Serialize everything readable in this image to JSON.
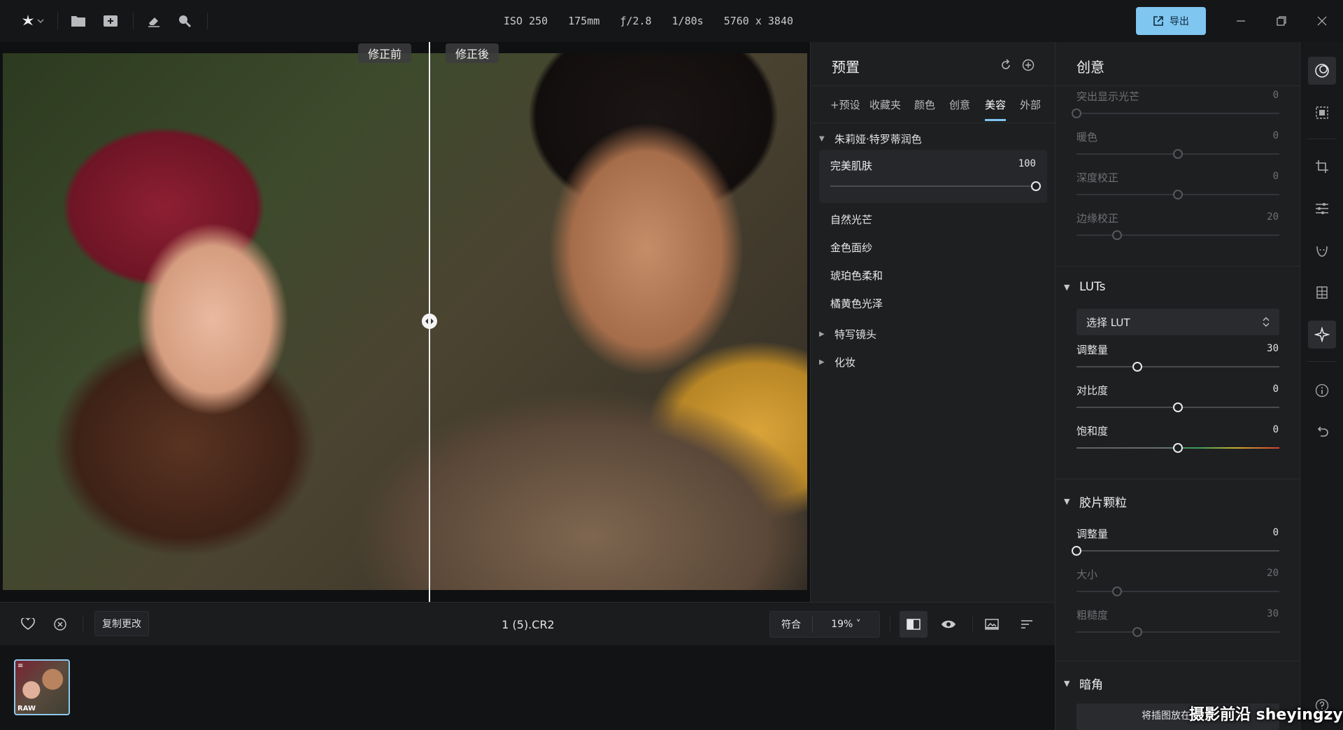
{
  "topbar": {
    "exif": [
      "ISO 250",
      "175mm",
      "ƒ/2.8",
      "1/80s",
      "5760 x 3840"
    ],
    "export_label": "导出",
    "icons": [
      "app-logo-star-icon",
      "chevron-down-icon",
      "folder-icon",
      "add-image-icon",
      "eraser-icon",
      "zoom-icon"
    ]
  },
  "viewer": {
    "before_label": "修正前",
    "after_label": "修正後"
  },
  "viewer_bottom": {
    "copy_label": "复制更改",
    "filename": "1 (5).CR2",
    "fit_label": "符合",
    "zoom_label": "19% ˅"
  },
  "filmstrip": {
    "thumb_badge": "RAW"
  },
  "presets": {
    "title": "预置",
    "tabs": [
      "+预设",
      "收藏夹",
      "颜色",
      "创意",
      "美容",
      "外部"
    ],
    "active_tab": "美容",
    "group_open": "朱莉娅·特罗蒂润色",
    "active_preset": {
      "label": "完美肌肤",
      "value": "100",
      "amount": 100
    },
    "items": [
      "自然光芒",
      "金色面纱",
      "琥珀色柔和",
      "橘黄色光泽"
    ],
    "group_closed_1": "特写镜头",
    "group_closed_2": "化妆"
  },
  "creative": {
    "title": "创意",
    "top_sliders": [
      {
        "label": "突出显示光芒",
        "value": "0",
        "pos": 0
      },
      {
        "label": "暖色",
        "value": "0",
        "pos": 0.5
      },
      {
        "label": "深度校正",
        "value": "0",
        "pos": 0.5
      },
      {
        "label": "边缘校正",
        "value": "20",
        "pos": 0.2
      }
    ],
    "luts": {
      "title": "LUTs",
      "select_label": "选择 LUT",
      "sliders": [
        {
          "label": "调整量",
          "value": "30",
          "pos": 0.3
        },
        {
          "label": "对比度",
          "value": "0",
          "pos": 0.5
        },
        {
          "label": "饱和度",
          "value": "0",
          "pos": 0.5
        }
      ]
    },
    "grain": {
      "title": "胶片颗粒",
      "sliders": [
        {
          "label": "调整量",
          "value": "0",
          "pos": 0
        },
        {
          "label": "大小",
          "value": "20",
          "pos": 0.2
        },
        {
          "label": "粗糙度",
          "value": "30",
          "pos": 0.3
        }
      ]
    },
    "vignette": {
      "title": "暗角",
      "partial_text": "将插图放在"
    }
  },
  "watermark": "摄影前沿 sheyingzyz.com",
  "colors": {
    "accent": "#7fc6f0",
    "panel": "#1e1f21",
    "topbar": "#151618"
  }
}
